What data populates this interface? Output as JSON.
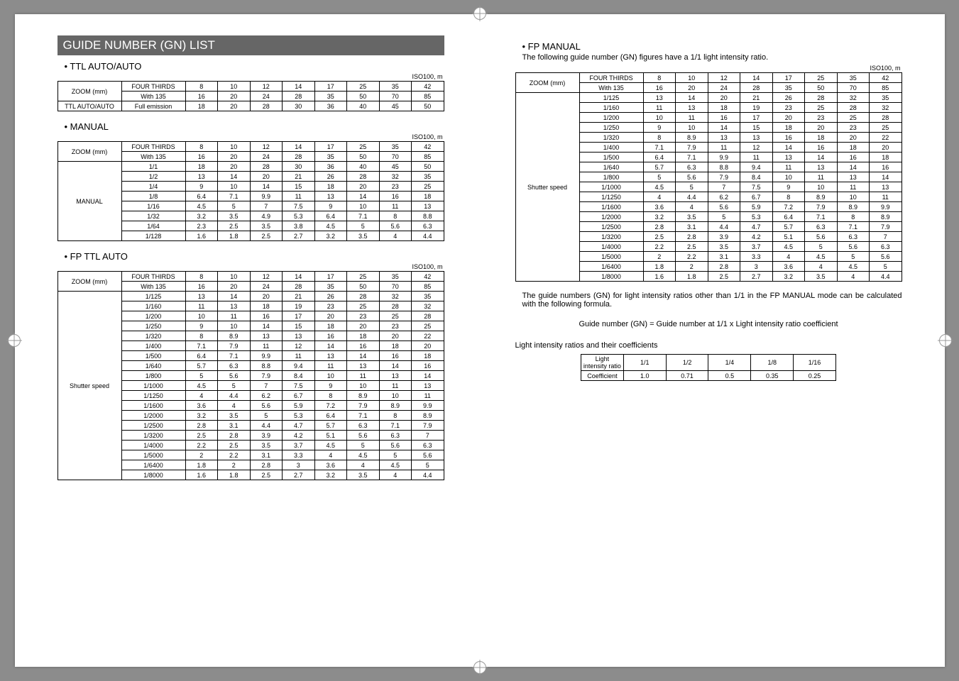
{
  "main_title": "GUIDE NUMBER (GN) LIST",
  "iso_label": "ISO100, m",
  "ttl_auto": {
    "title": "• TTL AUTO/AUTO",
    "row_labels": [
      "ZOOM (mm)",
      "TTL AUTO/AUTO"
    ],
    "sub_labels": [
      "FOUR THIRDS",
      "With 135",
      "Full emission"
    ],
    "rows": [
      [
        8,
        10,
        12,
        14,
        17,
        25,
        35,
        42
      ],
      [
        16,
        20,
        24,
        28,
        35,
        50,
        70,
        85
      ],
      [
        18,
        20,
        28,
        30,
        36,
        40,
        45,
        50
      ]
    ]
  },
  "manual": {
    "title": "• MANUAL",
    "row_label_top": "ZOOM (mm)",
    "row_label_side": "MANUAL",
    "sub_labels_top": [
      "FOUR THIRDS",
      "With 135"
    ],
    "fractions": [
      "1/1",
      "1/2",
      "1/4",
      "1/8",
      "1/16",
      "1/32",
      "1/64",
      "1/128"
    ],
    "zoom_rows": [
      [
        8,
        10,
        12,
        14,
        17,
        25,
        35,
        42
      ],
      [
        16,
        20,
        24,
        28,
        35,
        50,
        70,
        85
      ]
    ],
    "data": [
      [
        18,
        20,
        28,
        30,
        36,
        40,
        45,
        50
      ],
      [
        13,
        14,
        20,
        21,
        26,
        28,
        32,
        35
      ],
      [
        9.0,
        10,
        14,
        15,
        18,
        20,
        23,
        25
      ],
      [
        6.4,
        7.1,
        9.9,
        11,
        13,
        14,
        16,
        18
      ],
      [
        4.5,
        5.0,
        7.0,
        7.5,
        9.0,
        10,
        11,
        13
      ],
      [
        3.2,
        3.5,
        4.9,
        5.3,
        6.4,
        7.1,
        8.0,
        8.8
      ],
      [
        2.3,
        2.5,
        3.5,
        3.8,
        4.5,
        5.0,
        5.6,
        6.3
      ],
      [
        1.6,
        1.8,
        2.5,
        2.7,
        3.2,
        3.5,
        4.0,
        4.4
      ]
    ]
  },
  "fp_ttl": {
    "title": "• FP TTL AUTO",
    "row_label_top": "ZOOM (mm)",
    "row_label_side": "Shutter speed",
    "sub_labels_top": [
      "FOUR THIRDS",
      "With 135"
    ],
    "speeds": [
      "1/125",
      "1/160",
      "1/200",
      "1/250",
      "1/320",
      "1/400",
      "1/500",
      "1/640",
      "1/800",
      "1/1000",
      "1/1250",
      "1/1600",
      "1/2000",
      "1/2500",
      "1/3200",
      "1/4000",
      "1/5000",
      "1/6400",
      "1/8000"
    ],
    "zoom_rows": [
      [
        8,
        10,
        12,
        14,
        17,
        25,
        35,
        42
      ],
      [
        16,
        20,
        24,
        28,
        35,
        50,
        70,
        85
      ]
    ],
    "data": [
      [
        13,
        14,
        20,
        21,
        26,
        28,
        32,
        35
      ],
      [
        11,
        13,
        18,
        19,
        23,
        25,
        28,
        32
      ],
      [
        10,
        11,
        16,
        17,
        20,
        23,
        25,
        28
      ],
      [
        9.0,
        10,
        14,
        15,
        18,
        20,
        23,
        25
      ],
      [
        8.0,
        8.9,
        13,
        13,
        16,
        18,
        20,
        22
      ],
      [
        7.1,
        7.9,
        11,
        12,
        14,
        16,
        18,
        20
      ],
      [
        6.4,
        7.1,
        9.9,
        11,
        13,
        14,
        16,
        18
      ],
      [
        5.7,
        6.3,
        8.8,
        9.4,
        11,
        13,
        14,
        16
      ],
      [
        5.0,
        5.6,
        7.9,
        8.4,
        10,
        11,
        13,
        14
      ],
      [
        4.5,
        5.0,
        7.0,
        7.5,
        9.0,
        10,
        11,
        13
      ],
      [
        4.0,
        4.4,
        6.2,
        6.7,
        8.0,
        8.9,
        10,
        11
      ],
      [
        3.6,
        4.0,
        5.6,
        5.9,
        7.2,
        7.9,
        8.9,
        9.9
      ],
      [
        3.2,
        3.5,
        5.0,
        5.3,
        6.4,
        7.1,
        8.0,
        8.9
      ],
      [
        2.8,
        3.1,
        4.4,
        4.7,
        5.7,
        6.3,
        7.1,
        7.9
      ],
      [
        2.5,
        2.8,
        3.9,
        4.2,
        5.1,
        5.6,
        6.3,
        7.0
      ],
      [
        2.2,
        2.5,
        3.5,
        3.7,
        4.5,
        5.0,
        5.6,
        6.3
      ],
      [
        2.0,
        2.2,
        3.1,
        3.3,
        4.0,
        4.5,
        5.0,
        5.6
      ],
      [
        1.8,
        2.0,
        2.8,
        3.0,
        3.6,
        4.0,
        4.5,
        5.0
      ],
      [
        1.6,
        1.8,
        2.5,
        2.7,
        3.2,
        3.5,
        4.0,
        4.4
      ]
    ]
  },
  "fp_manual": {
    "title": "• FP MANUAL",
    "subtitle": "The following guide number (GN) figures have a 1/1 light intensity ratio.",
    "row_label_top": "ZOOM (mm)",
    "row_label_side": "Shutter speed",
    "sub_labels_top": [
      "FOUR THIRDS",
      "With 135"
    ],
    "speeds": [
      "1/125",
      "1/160",
      "1/200",
      "1/250",
      "1/320",
      "1/400",
      "1/500",
      "1/640",
      "1/800",
      "1/1000",
      "1/1250",
      "1/1600",
      "1/2000",
      "1/2500",
      "1/3200",
      "1/4000",
      "1/5000",
      "1/6400",
      "1/8000"
    ],
    "zoom_rows": [
      [
        8,
        10,
        12,
        14,
        17,
        25,
        35,
        42
      ],
      [
        16,
        20,
        24,
        28,
        35,
        50,
        70,
        85
      ]
    ],
    "data": [
      [
        13,
        14,
        20,
        21,
        26,
        28,
        32,
        35
      ],
      [
        11,
        13,
        18,
        19,
        23,
        25,
        28,
        32
      ],
      [
        10,
        11,
        16,
        17,
        20,
        23,
        25,
        28
      ],
      [
        9.0,
        10,
        14,
        15,
        18,
        20,
        23,
        25
      ],
      [
        8.0,
        8.9,
        13,
        13,
        16,
        18,
        20,
        22
      ],
      [
        7.1,
        7.9,
        11,
        12,
        14,
        16,
        18,
        20
      ],
      [
        6.4,
        7.1,
        9.9,
        11,
        13,
        14,
        16,
        18
      ],
      [
        5.7,
        6.3,
        8.8,
        9.4,
        11,
        13,
        14,
        16
      ],
      [
        5.0,
        5.6,
        7.9,
        8.4,
        10,
        11,
        13,
        14
      ],
      [
        4.5,
        5.0,
        7.0,
        7.5,
        9.0,
        10,
        11,
        13
      ],
      [
        4.0,
        4.4,
        6.2,
        6.7,
        8.0,
        8.9,
        10,
        11
      ],
      [
        3.6,
        4.0,
        5.6,
        5.9,
        7.2,
        7.9,
        8.9,
        9.9
      ],
      [
        3.2,
        3.5,
        5.0,
        5.3,
        6.4,
        7.1,
        8.0,
        8.9
      ],
      [
        2.8,
        3.1,
        4.4,
        4.7,
        5.7,
        6.3,
        7.1,
        7.9
      ],
      [
        2.5,
        2.8,
        3.9,
        4.2,
        5.1,
        5.6,
        6.3,
        7.0
      ],
      [
        2.2,
        2.5,
        3.5,
        3.7,
        4.5,
        5.0,
        5.6,
        6.3
      ],
      [
        2.0,
        2.2,
        3.1,
        3.3,
        4.0,
        4.5,
        5.0,
        5.6
      ],
      [
        1.8,
        2.0,
        2.8,
        3.0,
        3.6,
        4.0,
        4.5,
        5.0
      ],
      [
        1.6,
        1.8,
        2.5,
        2.7,
        3.2,
        3.5,
        4.0,
        4.4
      ]
    ]
  },
  "formula_para": "The guide numbers (GN) for light intensity ratios other than 1/1 in the FP MANUAL mode can be calculated with the following formula.",
  "formula": "Guide number (GN) = Guide number at 1/1 x Light intensity ratio coefficient",
  "coef_title": "Light intensity ratios and their coefficients",
  "coef": {
    "headers": [
      "Light intensity ratio",
      "1/1",
      "1/2",
      "1/4",
      "1/8",
      "1/16"
    ],
    "row2_label": "Coefficient",
    "values": [
      "1.0",
      "0.71",
      "0.5",
      "0.35",
      "0.25"
    ]
  }
}
